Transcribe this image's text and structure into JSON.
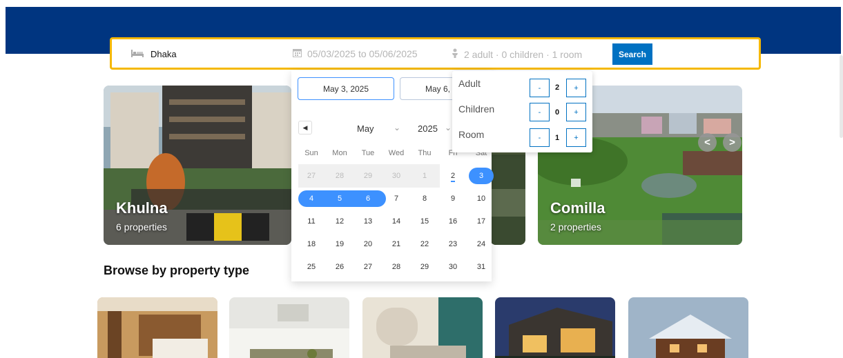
{
  "search": {
    "destination": "Dhaka",
    "dates": "05/03/2025 to 05/06/2025",
    "guests": "2 adult · 0 children · 1 room",
    "button_label": "Search"
  },
  "calendar": {
    "start_field": "May 3, 2025",
    "end_field": "May 6,",
    "prev_label": "◀",
    "month": "May",
    "year": "2025",
    "caret": "⌄",
    "weekdays": [
      "Sun",
      "Mon",
      "Tue",
      "Wed",
      "Thu",
      "Fri",
      "Sat"
    ],
    "weeks": [
      [
        "27",
        "28",
        "29",
        "30",
        "1",
        "2",
        "3"
      ],
      [
        "4",
        "5",
        "6",
        "7",
        "8",
        "9",
        "10"
      ],
      [
        "11",
        "12",
        "13",
        "14",
        "15",
        "16",
        "17"
      ],
      [
        "18",
        "19",
        "20",
        "21",
        "22",
        "23",
        "24"
      ],
      [
        "25",
        "26",
        "27",
        "28",
        "29",
        "30",
        "31"
      ]
    ]
  },
  "guests_panel": {
    "adult_label": "Adult",
    "adult_value": "2",
    "children_label": "Children",
    "children_value": "0",
    "room_label": "Room",
    "room_value": "1",
    "minus": "-",
    "plus": "+"
  },
  "featured": [
    {
      "name": "Khulna",
      "properties": "6 properties"
    },
    {
      "name": "Comilla",
      "properties": "2 properties"
    }
  ],
  "slider": {
    "prev": "<",
    "next": ">"
  },
  "browse_title": "Browse by property type",
  "colors": {
    "header": "#003580",
    "accent": "#0071c2",
    "highlight": "#f5b800",
    "calendar_selection": "#3d91ff"
  },
  "icons": {
    "bed": "bed-icon",
    "calendar": "calendar-icon",
    "person": "person-icon"
  }
}
